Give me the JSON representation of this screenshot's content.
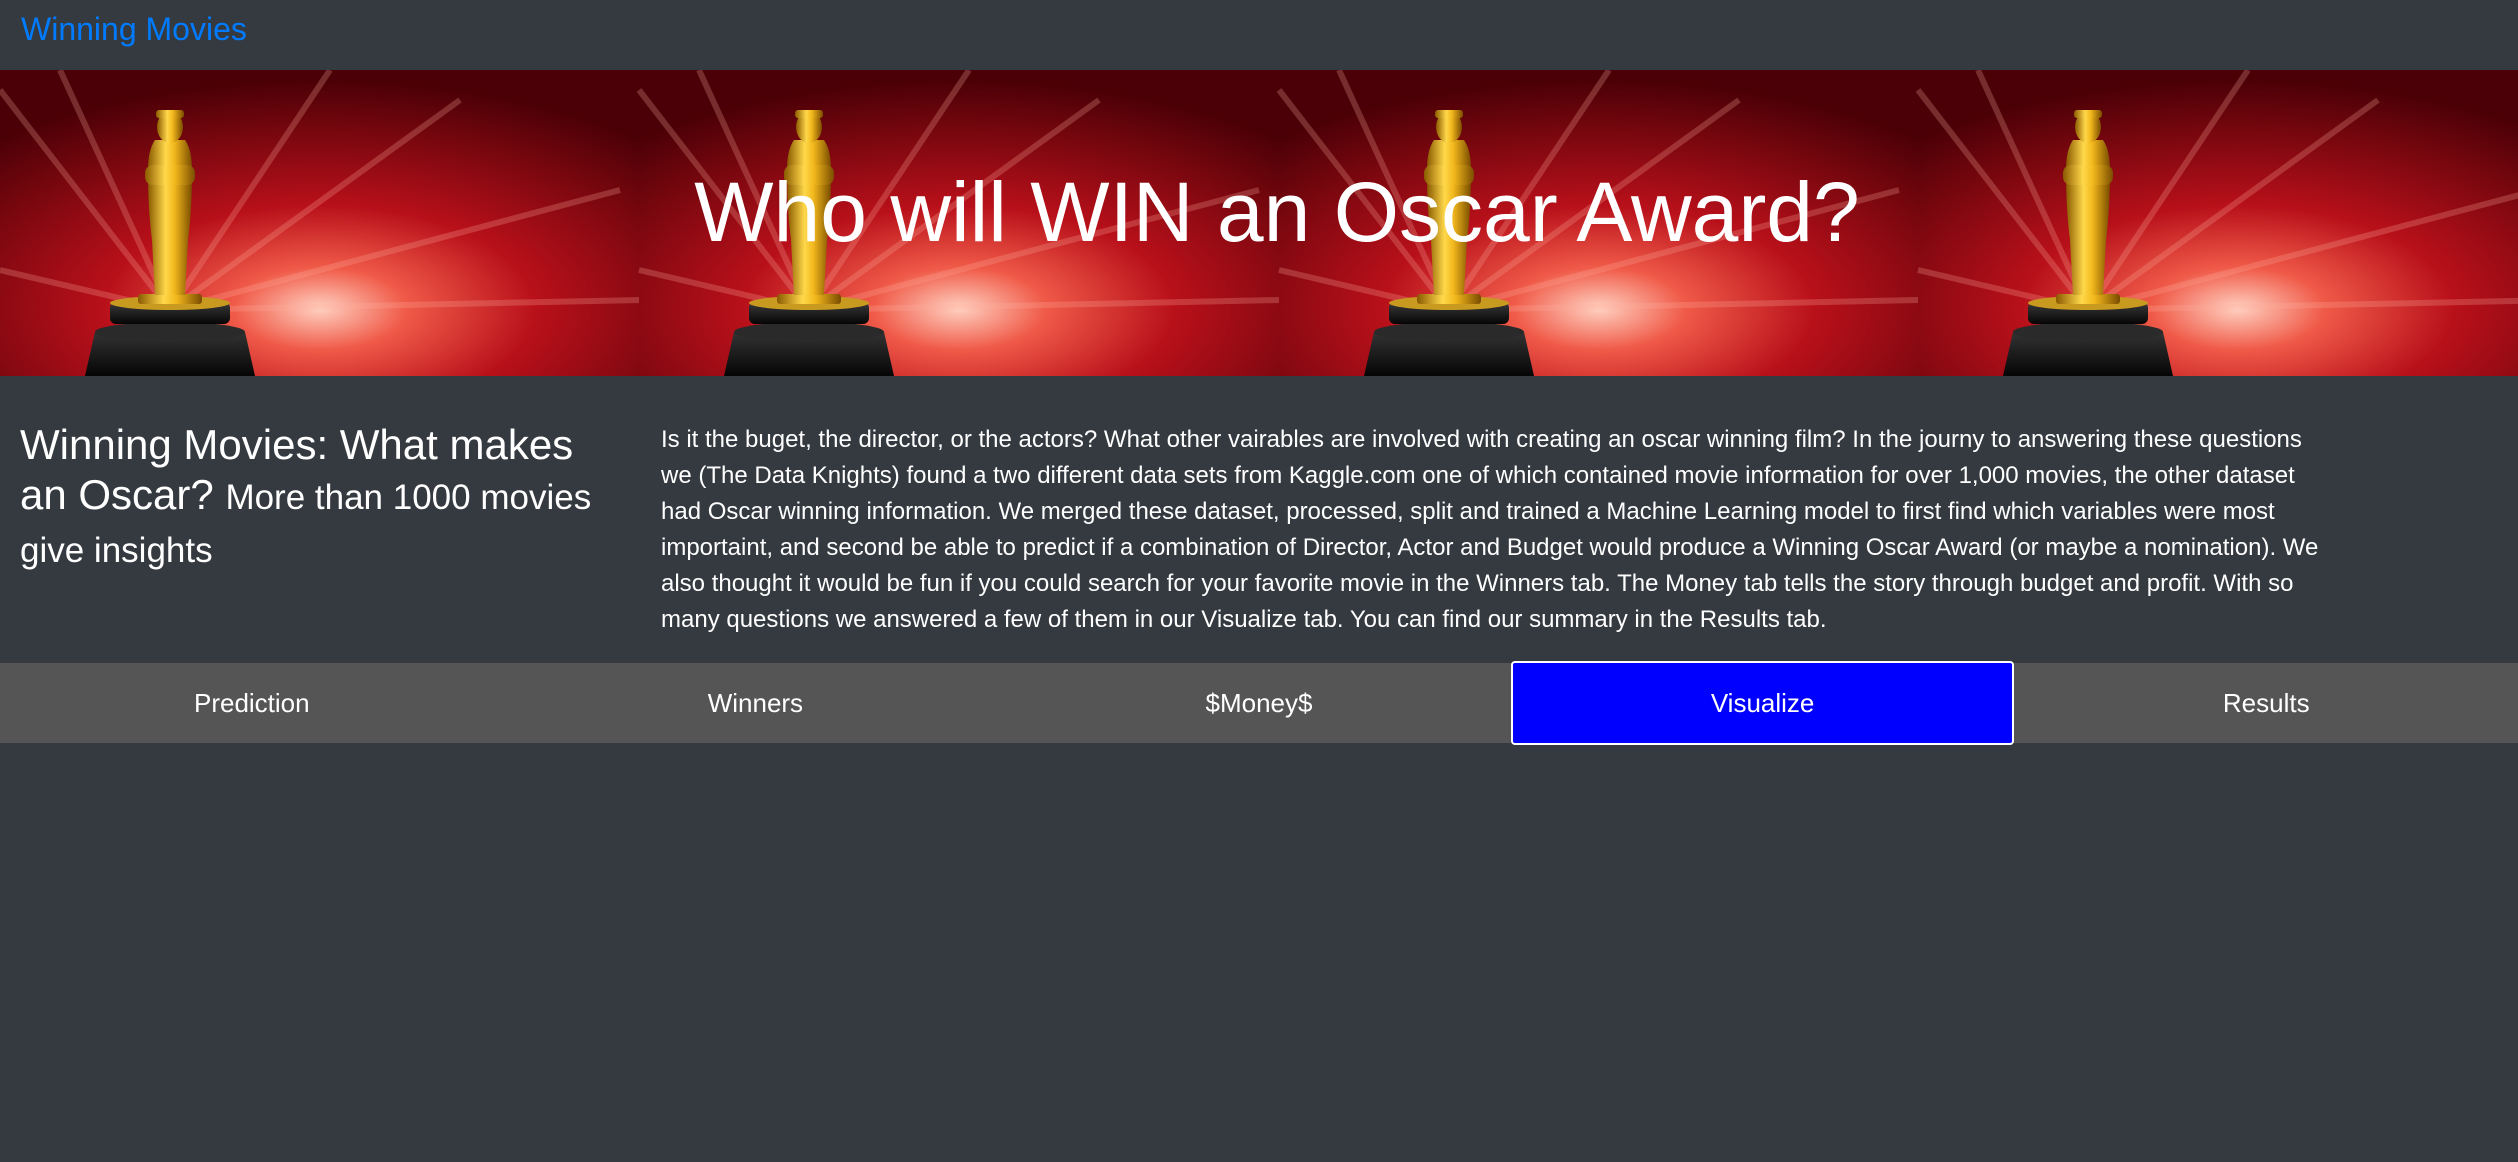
{
  "navbar": {
    "brand": "Winning Movies"
  },
  "hero": {
    "title": "Who will WIN an Oscar Award?"
  },
  "intro": {
    "heading": "Winning Movies: What makes an Oscar?",
    "subheading": "More than 1000 movies give insights",
    "paragraph": "Is it the buget, the director, or the actors? What other vairables are involved with creating an oscar winning film? In the journy to answering these questions we (The Data Knights) found a two different data sets from Kaggle.com one of which contained movie information for over 1,000 movies, the other dataset had Oscar winning information. We merged these dataset, processed, split and trained a Machine Learning model to first find which variables were most importaint, and second be able to predict if a combination of Director, Actor and Budget would produce a Winning Oscar Award (or maybe a nomination). We also thought it would be fun if you could search for your favorite movie in the Winners tab. The Money tab tells the story through budget and profit. With so many questions we answered a few of them in our Visualize tab. You can find our summary in the Results tab."
  },
  "tabs": [
    {
      "label": "Prediction"
    },
    {
      "label": "Winners"
    },
    {
      "label": "$Money$"
    },
    {
      "label": "Visualize",
      "active": true
    },
    {
      "label": "Results"
    }
  ],
  "colors": {
    "background": "#343a40",
    "brand": "#007bff",
    "tab_bar": "#555555",
    "active_tab": "#0000ff"
  }
}
